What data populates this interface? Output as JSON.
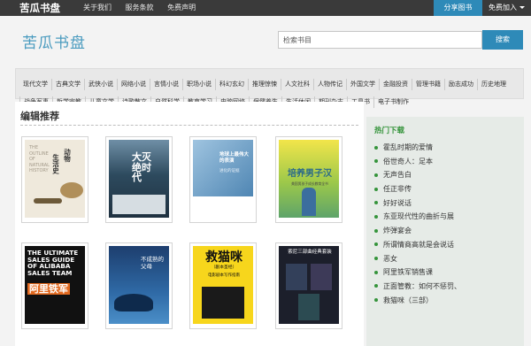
{
  "topbar": {
    "brand": "苦瓜书盘",
    "nav": [
      "关于我们",
      "服务条款",
      "免费声明"
    ],
    "share": "分享图书",
    "join": "免费加入"
  },
  "header": {
    "logo": "苦瓜书盘",
    "search_placeholder": "检索书目",
    "search_button": "搜索"
  },
  "categories": [
    "现代文学",
    "古典文学",
    "武侠小说",
    "网络小说",
    "言情小说",
    "职场小说",
    "科幻玄幻",
    "推理惊悚",
    "人文社科",
    "人物传记",
    "外国文学",
    "金融投资",
    "管理书籍",
    "励志成功",
    "历史地理",
    "战争军事",
    "哲学宗教",
    "儿童文学",
    "诗歌散文",
    "自然科学",
    "教育学习",
    "电脑网络",
    "保健养生",
    "生活休闲",
    "期刊杂志",
    "工具书",
    "电子书制作"
  ],
  "main": {
    "section_title": "编辑推荐",
    "books": [
      {
        "title": "生活史",
        "title2": "动物",
        "sub": "THE OUTLINE OF NATURAL HISTORY"
      },
      {
        "title": "大灭绝时代",
        "sub": ""
      },
      {
        "title": "地球上最伟大的表演",
        "sub": "进化的证据"
      },
      {
        "title": "培养男子汉",
        "sub": "美国男孩子成长教育全书"
      },
      {
        "title": "THE ULTIMATE SALES GUIDE OF ALIBABA SALES TEAM",
        "title2": "阿里铁军"
      },
      {
        "title": "不成熟的父母",
        "sub": ""
      },
      {
        "title": "救猫咪",
        "sub": "（剧本圣经）",
        "sub2": "电影剧本写作指南"
      },
      {
        "title": "索尼三部曲经典套装",
        "sub": ""
      }
    ]
  },
  "side": {
    "title": "热门下载",
    "items": [
      "霍乱时期的爱情",
      "俗世奇人：足本",
      "无声告白",
      "任正非传",
      "好好说话",
      "东亚现代性的曲折与展",
      "炸弹宴会",
      "所谓情商高就是会说话",
      "恶女",
      "阿里铁军销售课",
      "正面管教：如何不惩罚、",
      "救猫咪（三部）"
    ]
  }
}
